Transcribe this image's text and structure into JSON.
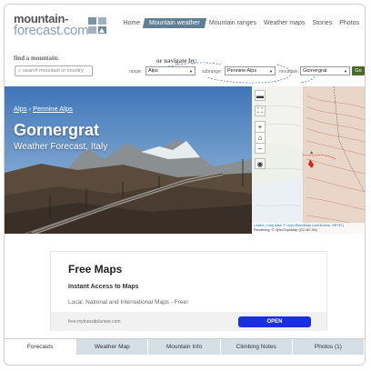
{
  "logo": {
    "line1": "mountain-",
    "line2": "forecast.com"
  },
  "nav": [
    "Home",
    "Mountain weather",
    "Mountain ranges",
    "Weather maps",
    "Stories",
    "Photos"
  ],
  "nav_active": "Mountain weather",
  "find": {
    "label": "find a mountain:",
    "placeholder": "search mountain or country",
    "navigate_label": "or navigate by:",
    "range_label": "range:",
    "range_value": "Alps",
    "subrange_label": "subrange:",
    "subrange_value": "Pennine Alps",
    "mountain_label": "mountain:",
    "mountain_value": "Gornergrat",
    "go_label": "Go"
  },
  "hero": {
    "breadcrumb": [
      "Alps",
      "Pennine Alps"
    ],
    "title": "Gornergrat",
    "subtitle": "Weather Forecast, Italy"
  },
  "map": {
    "attribution_1": "Leaflet | Map data: © OpenStreetMap contributors, SRTM |",
    "attribution_2": "Rendering: © OpenTopoMap (CC-BY-SA)"
  },
  "ad": {
    "title": "Free Maps",
    "headline": "Instant Access to Maps",
    "desc": "Local, National and International Maps - Free!",
    "url": "free.mytransitplanner.com",
    "button": "OPEN"
  },
  "tabs": [
    "Forecasts",
    "Weather Map",
    "Mountain Info",
    "Climbing Notes",
    "Photos (1)"
  ],
  "colors": {
    "nav_active": "#5f7f95",
    "tab_bg": "#d7dfe6",
    "ad_button": "#1a2ee6",
    "go_button": "#4a6a2a"
  }
}
